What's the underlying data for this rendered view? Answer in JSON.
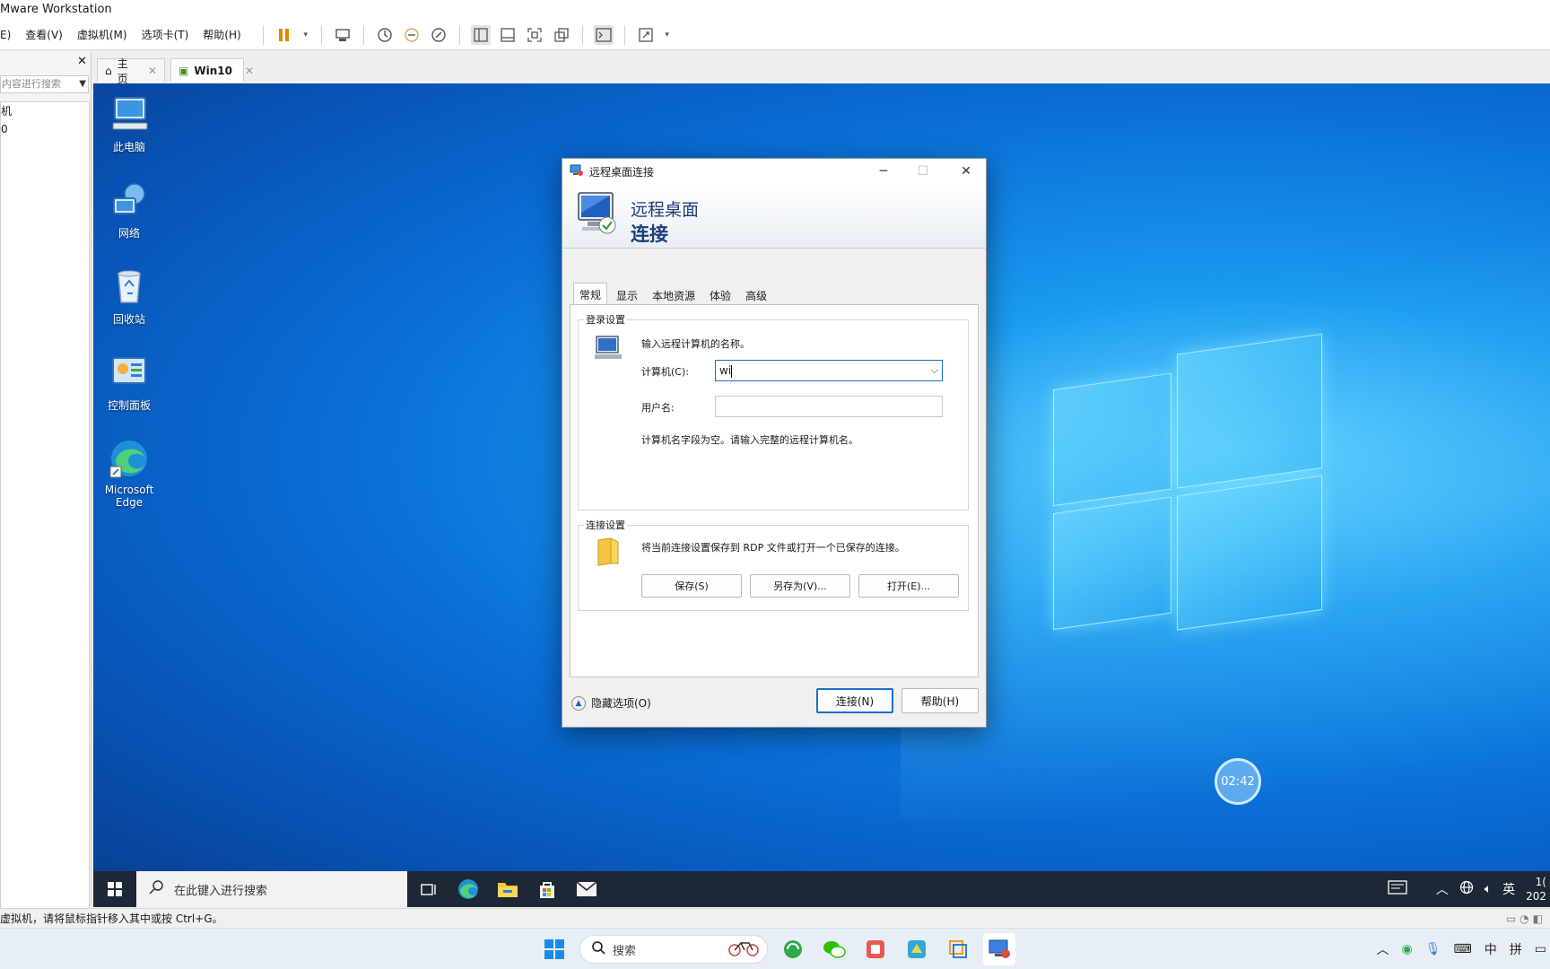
{
  "vmware": {
    "title": "Mware Workstation",
    "menu": [
      "E)",
      "查看(V)",
      "虚拟机(M)",
      "选项卡(T)",
      "帮助(H)"
    ],
    "sidebar": {
      "search_placeholder": "内容进行搜索",
      "tree": [
        "机",
        "0"
      ]
    },
    "tabs": [
      {
        "label": "主页"
      },
      {
        "label": "Win10"
      }
    ],
    "status_text": "虚拟机，请将鼠标指针移入其中或按 Ctrl+G。"
  },
  "desktop": {
    "icons": [
      {
        "label": "此电脑",
        "icon": "computer-icon"
      },
      {
        "label": "网络",
        "icon": "network-icon"
      },
      {
        "label": "回收站",
        "icon": "recycle-bin-icon"
      },
      {
        "label": "控制面板",
        "icon": "control-panel-icon"
      },
      {
        "label": "Microsoft Edge",
        "icon": "edge-icon"
      }
    ],
    "timer": "02:42"
  },
  "win10_taskbar": {
    "search_placeholder": "在此键入进行搜索",
    "tray": {
      "lang": "英",
      "time_partial": "1(",
      "date_partial": "202"
    }
  },
  "rdp": {
    "window_title": "远程桌面连接",
    "banner_line1": "远程桌面",
    "banner_line2": "连接",
    "tabs": [
      "常规",
      "显示",
      "本地资源",
      "体验",
      "高级"
    ],
    "active_tab": "常规",
    "login_group": {
      "label": "登录设置",
      "hint": "输入远程计算机的名称。",
      "computer_label": "计算机(C):",
      "computer_value": "wi",
      "username_label": "用户名:",
      "username_value": "",
      "warning": "计算机名字段为空。请输入完整的远程计算机名。"
    },
    "connection_group": {
      "label": "连接设置",
      "hint": "将当前连接设置保存到 RDP 文件或打开一个已保存的连接。",
      "save": "保存(S)",
      "save_as": "另存为(V)...",
      "open": "打开(E)..."
    },
    "hide_options": "隐藏选项(O)",
    "connect": "连接(N)",
    "help": "帮助(H)"
  },
  "win11_taskbar": {
    "search_placeholder": "搜索",
    "tray": {
      "ime1": "中",
      "ime2": "拼"
    }
  }
}
